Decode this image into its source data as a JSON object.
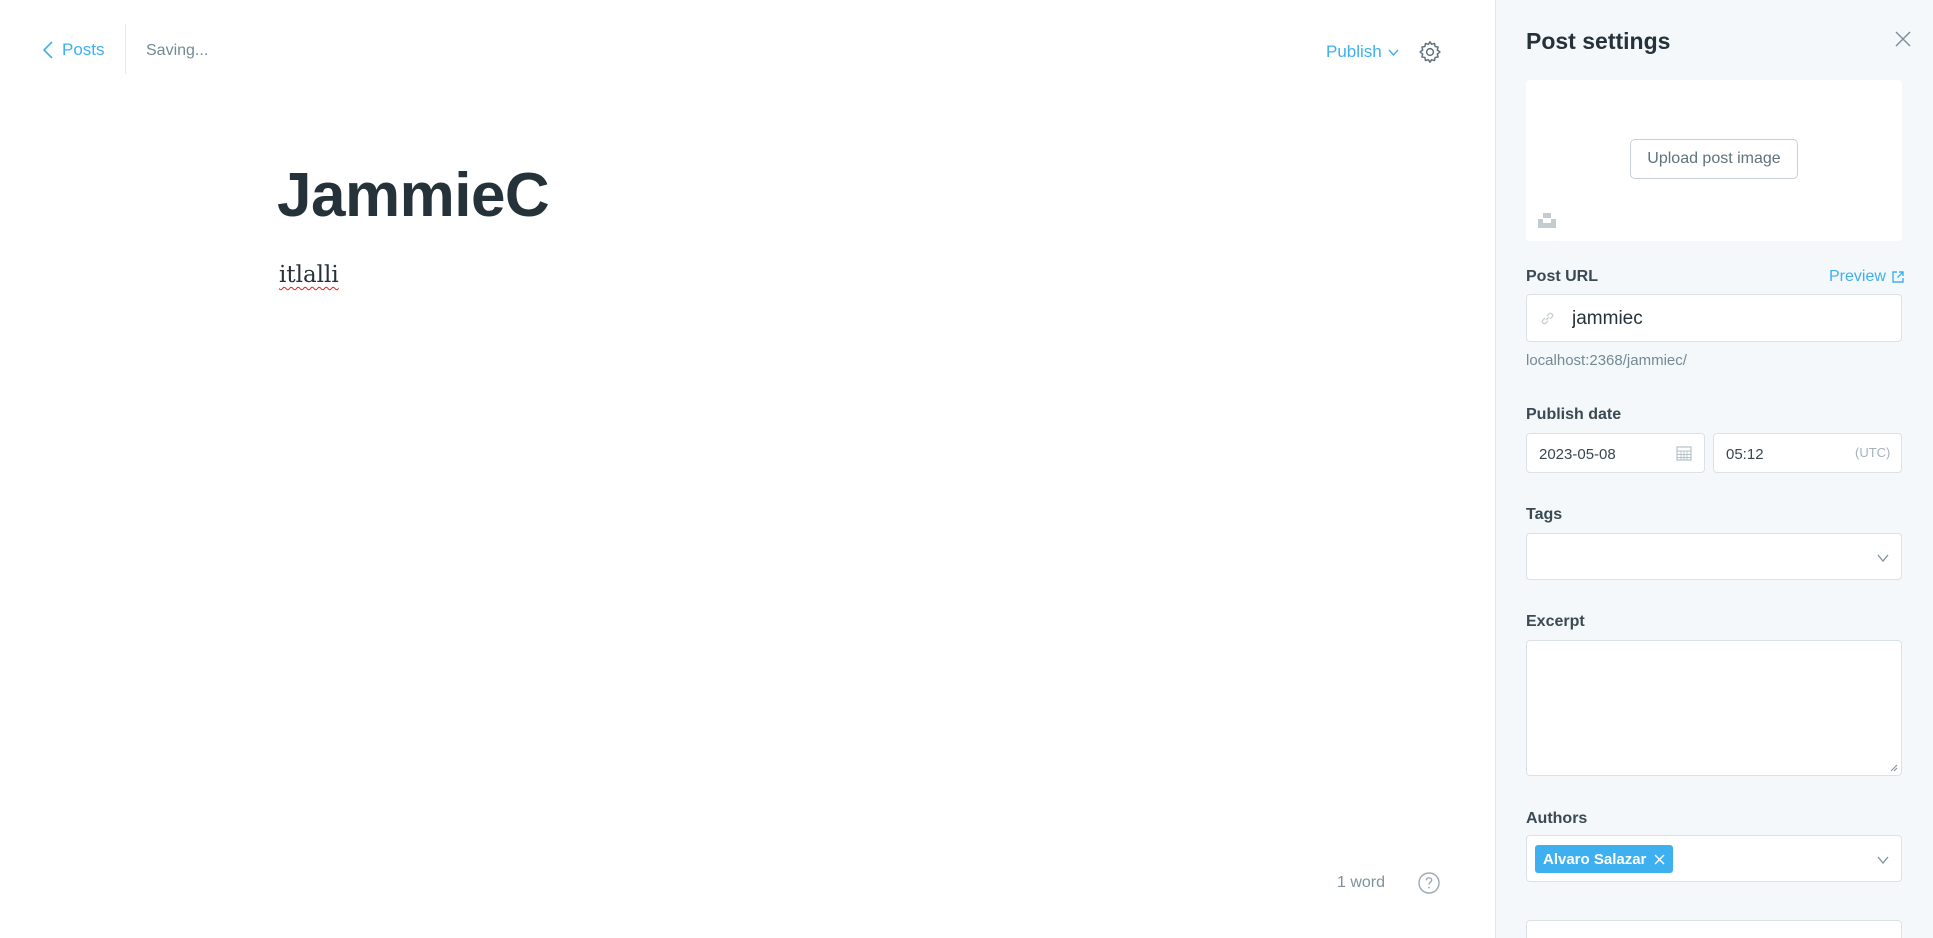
{
  "toolbar": {
    "back_label": "Posts",
    "status": "Saving...",
    "publish_label": "Publish"
  },
  "post": {
    "title": "JammieC",
    "body": "itlalli"
  },
  "footer": {
    "word_count": "1 word"
  },
  "sidebar": {
    "title": "Post settings",
    "upload_label": "Upload post image",
    "post_url_label": "Post URL",
    "preview_label": "Preview",
    "url_value": "jammiec",
    "url_hint": "localhost:2368/jammiec/",
    "publish_date_label": "Publish date",
    "date_value": "2023-05-08",
    "time_value": "05:12",
    "timezone": "(UTC)",
    "tags_label": "Tags",
    "excerpt_label": "Excerpt",
    "excerpt_value": "",
    "authors_label": "Authors",
    "authors": [
      "Alvaro Salazar"
    ]
  },
  "colors": {
    "accent": "#3eb0ef",
    "sidebar_bg": "#f4f8fb",
    "title_text": "#26323a"
  },
  "icons": [
    "chevron-left-icon",
    "chevron-down-icon",
    "gear-icon",
    "help-icon",
    "close-icon",
    "unsplash-icon",
    "external-link-icon",
    "link-icon",
    "calendar-icon",
    "remove-icon"
  ]
}
